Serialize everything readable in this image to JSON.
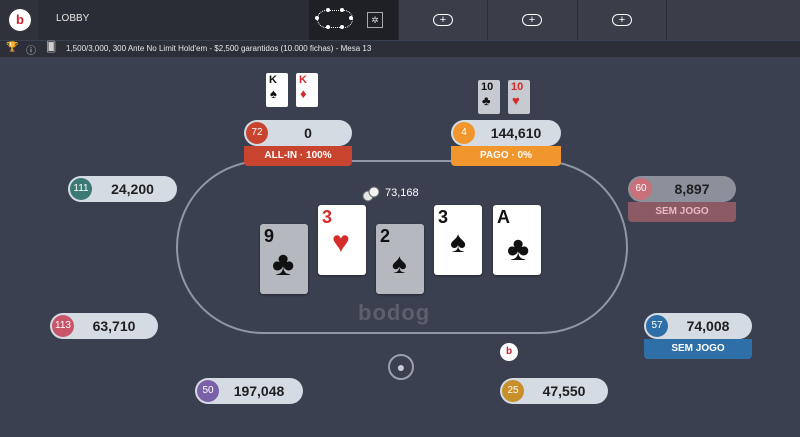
{
  "topbar": {
    "logo_letter": "b",
    "lobby_label": "LOBBY",
    "tabs": [
      {
        "plus": "+"
      },
      {
        "plus": "+"
      },
      {
        "plus": "+"
      }
    ],
    "mini_icon": "✲"
  },
  "infobar": {
    "icons": [
      "trophy-icon",
      "info-icon",
      "cards-icon"
    ],
    "text": "1,500/3,000, 300 Ante No Limit Hold'em - $2,500 garantidos (10.000 fichas) - Mesa 13"
  },
  "table": {
    "watermark": "bodog",
    "pot": "73,168",
    "dealer_letter": "b",
    "avatar_icon": "user-icon"
  },
  "board": [
    {
      "rank": "9",
      "suit": "♣",
      "color": "blk",
      "dim": true
    },
    {
      "rank": "3",
      "suit": "♥",
      "color": "red",
      "dim": false
    },
    {
      "rank": "2",
      "suit": "♠",
      "color": "blk",
      "dim": true
    },
    {
      "rank": "3",
      "suit": "♠",
      "color": "blk",
      "dim": false
    },
    {
      "rank": "A",
      "suit": "♣",
      "color": "blk",
      "dim": false
    }
  ],
  "players": {
    "p72": {
      "seat": "72",
      "stack": "0",
      "status": "ALL-IN · 100%",
      "badge_color": "#c9442f",
      "status_color": "#c9442f",
      "cards": [
        {
          "rank": "K",
          "suit": "♠",
          "color": "blk"
        },
        {
          "rank": "K",
          "suit": "♦",
          "color": "red"
        }
      ]
    },
    "p4": {
      "seat": "4",
      "stack": "144,610",
      "status": "PAGO · 0%",
      "badge_color": "#f0962d",
      "status_color": "#f0962d",
      "cards": [
        {
          "rank": "10",
          "suit": "♣",
          "color": "blk"
        },
        {
          "rank": "10",
          "suit": "♥",
          "color": "red"
        }
      ]
    },
    "p111": {
      "seat": "111",
      "stack": "24,200",
      "badge_color": "#3b7a74"
    },
    "p60": {
      "seat": "60",
      "stack": "8,897",
      "status": "SEM JOGO",
      "badge_color": "#c9707a",
      "status_color": "#c47680"
    },
    "p113": {
      "seat": "113",
      "stack": "63,710",
      "badge_color": "#c9556a"
    },
    "p57": {
      "seat": "57",
      "stack": "74,008",
      "status": "SEM JOGO",
      "badge_color": "#2f6fa8",
      "status_color": "#2f6fa8"
    },
    "p50": {
      "seat": "50",
      "stack": "197,048",
      "badge_color": "#7a60a8"
    },
    "p25": {
      "seat": "25",
      "stack": "47,550",
      "badge_color": "#c88f2a"
    }
  }
}
